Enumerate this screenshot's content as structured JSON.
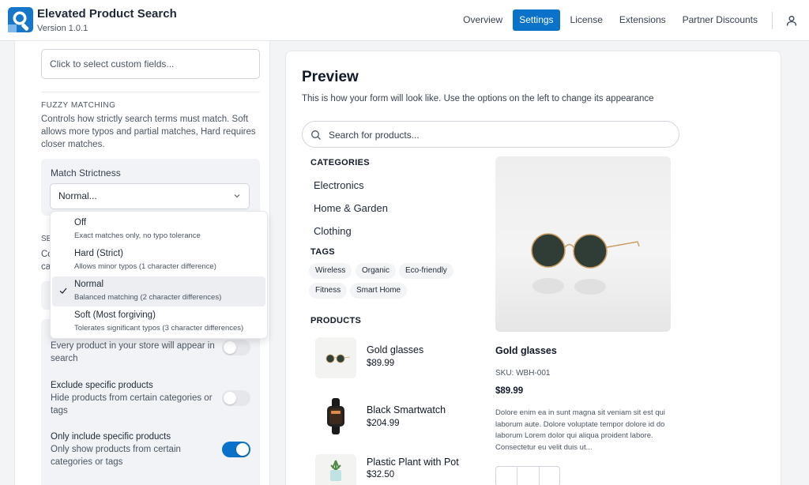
{
  "app": {
    "title": "Elevated Product Search",
    "version": "Version 1.0.1"
  },
  "nav": {
    "items": [
      {
        "label": "Overview",
        "active": false
      },
      {
        "label": "Settings",
        "active": true
      },
      {
        "label": "License",
        "active": false
      },
      {
        "label": "Extensions",
        "active": false
      },
      {
        "label": "Partner Discounts",
        "active": false
      }
    ],
    "user_icon": "user-icon"
  },
  "settings": {
    "custom_fields_placeholder": "Click to select custom fields...",
    "fuzzy": {
      "label": "FUZZY MATCHING",
      "description": "Controls how strictly search terms must match. Soft allows more typos and partial matches, Hard requires closer matches.",
      "strictness_label": "Match Strictness",
      "strictness_value": "Normal..."
    },
    "hidden_section_label": "SE",
    "hidden_section_desc_1": "Co",
    "hidden_section_desc_2": "ca",
    "options": [
      {
        "title": "",
        "desc": "Every product in your store will appear in search",
        "on": false
      },
      {
        "title": "Exclude specific products",
        "desc": "Hide products from certain categories or tags",
        "on": false
      },
      {
        "title": "Only include specific products",
        "desc": "Only show products from certain categories or tags",
        "on": true
      }
    ],
    "dropdown": [
      {
        "title": "Off",
        "desc": "Exact matches only, no typo tolerance",
        "selected": false
      },
      {
        "title": "Hard (Strict)",
        "desc": "Allows minor typos (1 character difference)",
        "selected": false
      },
      {
        "title": "Normal",
        "desc": "Balanced matching (2 character differences)",
        "selected": true
      },
      {
        "title": "Soft (Most forgiving)",
        "desc": "Tolerates significant typos (3 character differences)",
        "selected": false
      }
    ]
  },
  "preview": {
    "title": "Preview",
    "description": "This is how your form will look like. Use the options on the left to change its appearance",
    "search_placeholder": "Search for products...",
    "categories_heading": "CATEGORIES",
    "categories": [
      "Electronics",
      "Home & Garden",
      "Clothing"
    ],
    "tags_heading": "TAGS",
    "tags": [
      "Wireless",
      "Organic",
      "Eco-friendly",
      "Fitness",
      "Smart Home"
    ],
    "products_heading": "PRODUCTS",
    "products": [
      {
        "name": "Gold glasses",
        "price": "$89.99"
      },
      {
        "name": "Black Smartwatch",
        "price": "$204.99"
      },
      {
        "name": "Plastic Plant with Pot",
        "price": "$32.50"
      }
    ],
    "detail": {
      "name": "Gold glasses",
      "sku": "SKU: WBH-001",
      "price": "$89.99",
      "description": "Dolore enim ea in sunt magna sit veniam sit est qui laborum aute. Dolore voluptate tempor dolore id do laborum Lorem dolor qui aliqua proident labore. Consectetur eu velit duis ut..."
    }
  },
  "colors": {
    "accent": "#0b72c9",
    "panel_bg": "#f1f3f6"
  }
}
